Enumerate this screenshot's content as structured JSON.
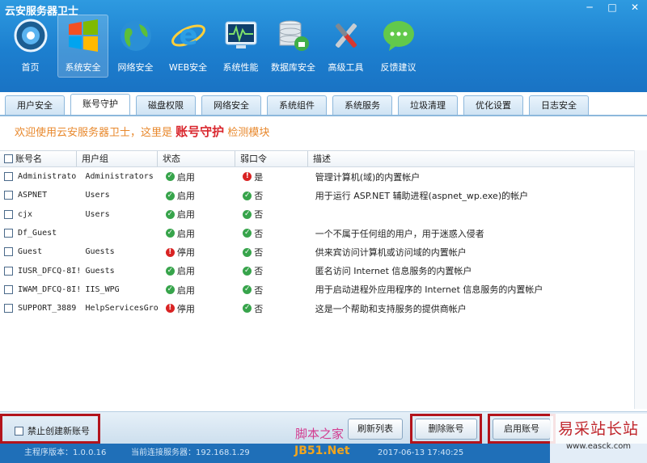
{
  "app": {
    "title": "云安服务器卫士",
    "window_controls": [
      "─",
      "□",
      "✕"
    ]
  },
  "nav": [
    {
      "label": "首页",
      "icon": "home-icon"
    },
    {
      "label": "系统安全",
      "icon": "windows-icon",
      "active": true
    },
    {
      "label": "网络安全",
      "icon": "globe-icon"
    },
    {
      "label": "WEB安全",
      "icon": "ie-icon"
    },
    {
      "label": "系统性能",
      "icon": "monitor-icon"
    },
    {
      "label": "数据库安全",
      "icon": "database-icon"
    },
    {
      "label": "高级工具",
      "icon": "tools-icon"
    },
    {
      "label": "反馈建议",
      "icon": "chat-icon"
    }
  ],
  "tabs": [
    {
      "label": "用户安全"
    },
    {
      "label": "账号守护",
      "active": true
    },
    {
      "label": "磁盘权限"
    },
    {
      "label": "网络安全"
    },
    {
      "label": "系统组件"
    },
    {
      "label": "系统服务"
    },
    {
      "label": "垃圾清理"
    },
    {
      "label": "优化设置"
    },
    {
      "label": "日志安全"
    }
  ],
  "welcome": {
    "prefix": "欢迎使用云安服务器卫士，这里是",
    "highlight": "账号守护",
    "suffix": "检测模块"
  },
  "table": {
    "headers": {
      "name": "账号名",
      "group": "用户组",
      "status": "状态",
      "weak": "弱口令",
      "desc": "描述"
    },
    "rows": [
      {
        "name": "Administrato",
        "group": "Administrators",
        "status": "启用",
        "status_ok": true,
        "weak": "是",
        "weak_ok": false,
        "desc": "管理计算机(域)的内置帐户"
      },
      {
        "name": "ASPNET",
        "group": "Users",
        "status": "启用",
        "status_ok": true,
        "weak": "否",
        "weak_ok": true,
        "desc": "用于运行 ASP.NET 辅助进程(aspnet_wp.exe)的帐户"
      },
      {
        "name": "cjx",
        "group": "Users",
        "status": "启用",
        "status_ok": true,
        "weak": "否",
        "weak_ok": true,
        "desc": ""
      },
      {
        "name": "Df_Guest",
        "group": "",
        "status": "启用",
        "status_ok": true,
        "weak": "否",
        "weak_ok": true,
        "desc": "一个不属于任何组的用户，用于迷惑入侵者"
      },
      {
        "name": "Guest",
        "group": "Guests",
        "status": "停用",
        "status_ok": false,
        "weak": "否",
        "weak_ok": true,
        "desc": "供来宾访问计算机或访问域的内置帐户"
      },
      {
        "name": "IUSR_DFCQ-8I!",
        "group": "Guests",
        "status": "启用",
        "status_ok": true,
        "weak": "否",
        "weak_ok": true,
        "desc": "匿名访问 Internet 信息服务的内置帐户"
      },
      {
        "name": "IWAM_DFCQ-8I!",
        "group": "IIS_WPG",
        "status": "启用",
        "status_ok": true,
        "weak": "否",
        "weak_ok": true,
        "desc": "用于启动进程外应用程序的 Internet 信息服务的内置帐户"
      },
      {
        "name": "SUPPORT_3889",
        "group": "HelpServicesGro",
        "status": "停用",
        "status_ok": false,
        "weak": "否",
        "weak_ok": true,
        "desc": "这是一个帮助和支持服务的提供商帐户"
      }
    ]
  },
  "bottom": {
    "disable_new_label": "禁止创建新账号",
    "refresh_label": "刷新列表",
    "delete_label": "删除账号",
    "enable_label": "启用账号"
  },
  "status": {
    "version": "主程序版本：1.0.0.16",
    "server": "当前连接服务器：192.168.1.29",
    "time": "2017-06-13 17:40:25"
  },
  "watermarks": {
    "jb51_top": "脚本之家",
    "jb51_bottom": "JB51.Net",
    "easck_title": "易采站长站",
    "easck_url": "www.easck.com"
  },
  "colors": {
    "accent": "#1c7fcf",
    "highlight_red": "#d9272e",
    "welcome_orange": "#e8882c",
    "ok_green": "#37a44b",
    "bad_red": "#d92323",
    "callout_red": "#b3141c"
  }
}
